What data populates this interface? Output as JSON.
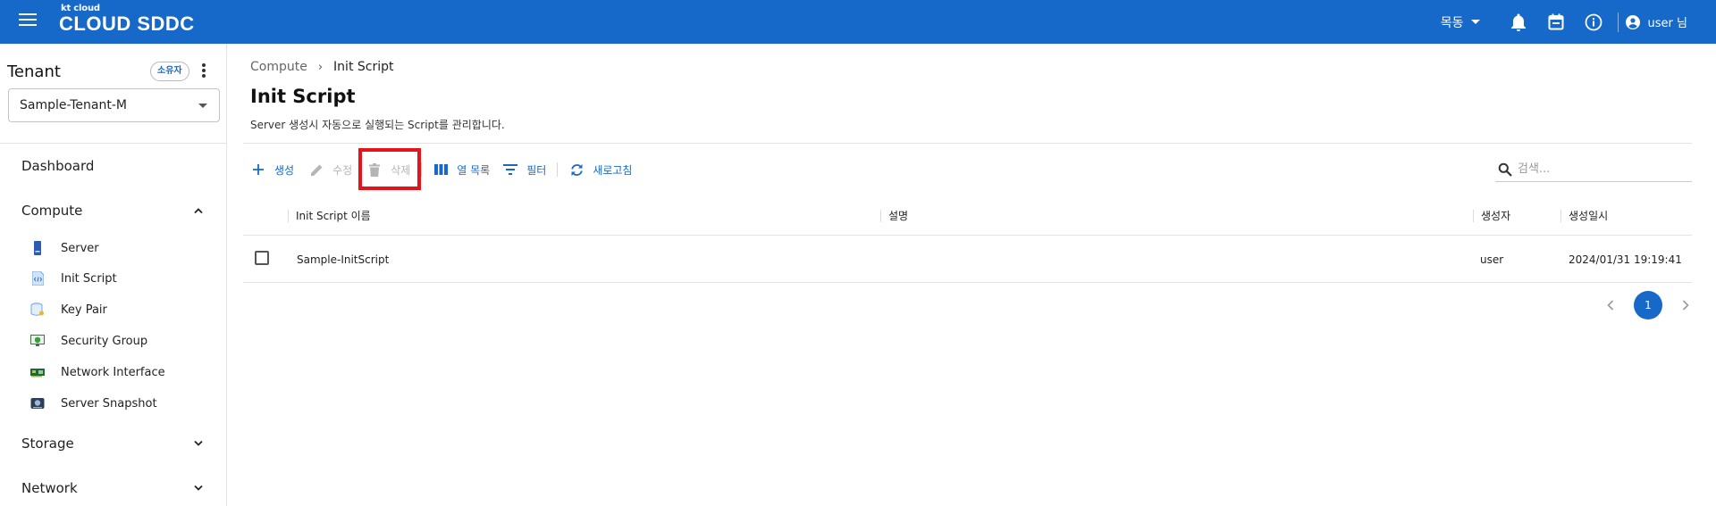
{
  "header": {
    "logo_small": "kt cloud",
    "logo_brand": "CLOUD SDDC",
    "region": "목동",
    "user_label": "user 님"
  },
  "sidebar": {
    "tenant_title": "Tenant",
    "owner_badge": "소유자",
    "tenant_selected": "Sample-Tenant-M",
    "nav": {
      "dashboard": "Dashboard",
      "compute": "Compute",
      "storage": "Storage",
      "network": "Network"
    },
    "compute_items": [
      {
        "label": "Server",
        "icon": "server-icon"
      },
      {
        "label": "Init Script",
        "icon": "script-icon"
      },
      {
        "label": "Key Pair",
        "icon": "key-pair-icon"
      },
      {
        "label": "Security Group",
        "icon": "security-group-icon"
      },
      {
        "label": "Network Interface",
        "icon": "network-interface-icon"
      },
      {
        "label": "Server Snapshot",
        "icon": "snapshot-icon"
      }
    ]
  },
  "breadcrumb": {
    "parent": "Compute",
    "separator": "›",
    "current": "Init Script"
  },
  "page": {
    "title": "Init Script",
    "description": "Server 생성시 자동으로 실행되는 Script를 관리합니다."
  },
  "toolbar": {
    "create": "생성",
    "edit": "수정",
    "delete": "삭제",
    "columns": "열 목록",
    "filter": "필터",
    "refresh": "새로고침"
  },
  "search": {
    "placeholder": "검색..."
  },
  "table": {
    "columns": [
      "Init Script 이름",
      "설명",
      "생성자",
      "생성일시"
    ],
    "rows": [
      {
        "name": "Sample-InitScript",
        "description": "",
        "creator": "user",
        "created_at": "2024/01/31 19:19:41"
      }
    ]
  },
  "pagination": {
    "current_page": "1"
  },
  "colors": {
    "header_bg": "#1669c9",
    "accent": "#1669c9",
    "highlight": "#e5141a",
    "disabled": "#b5b5b5"
  }
}
